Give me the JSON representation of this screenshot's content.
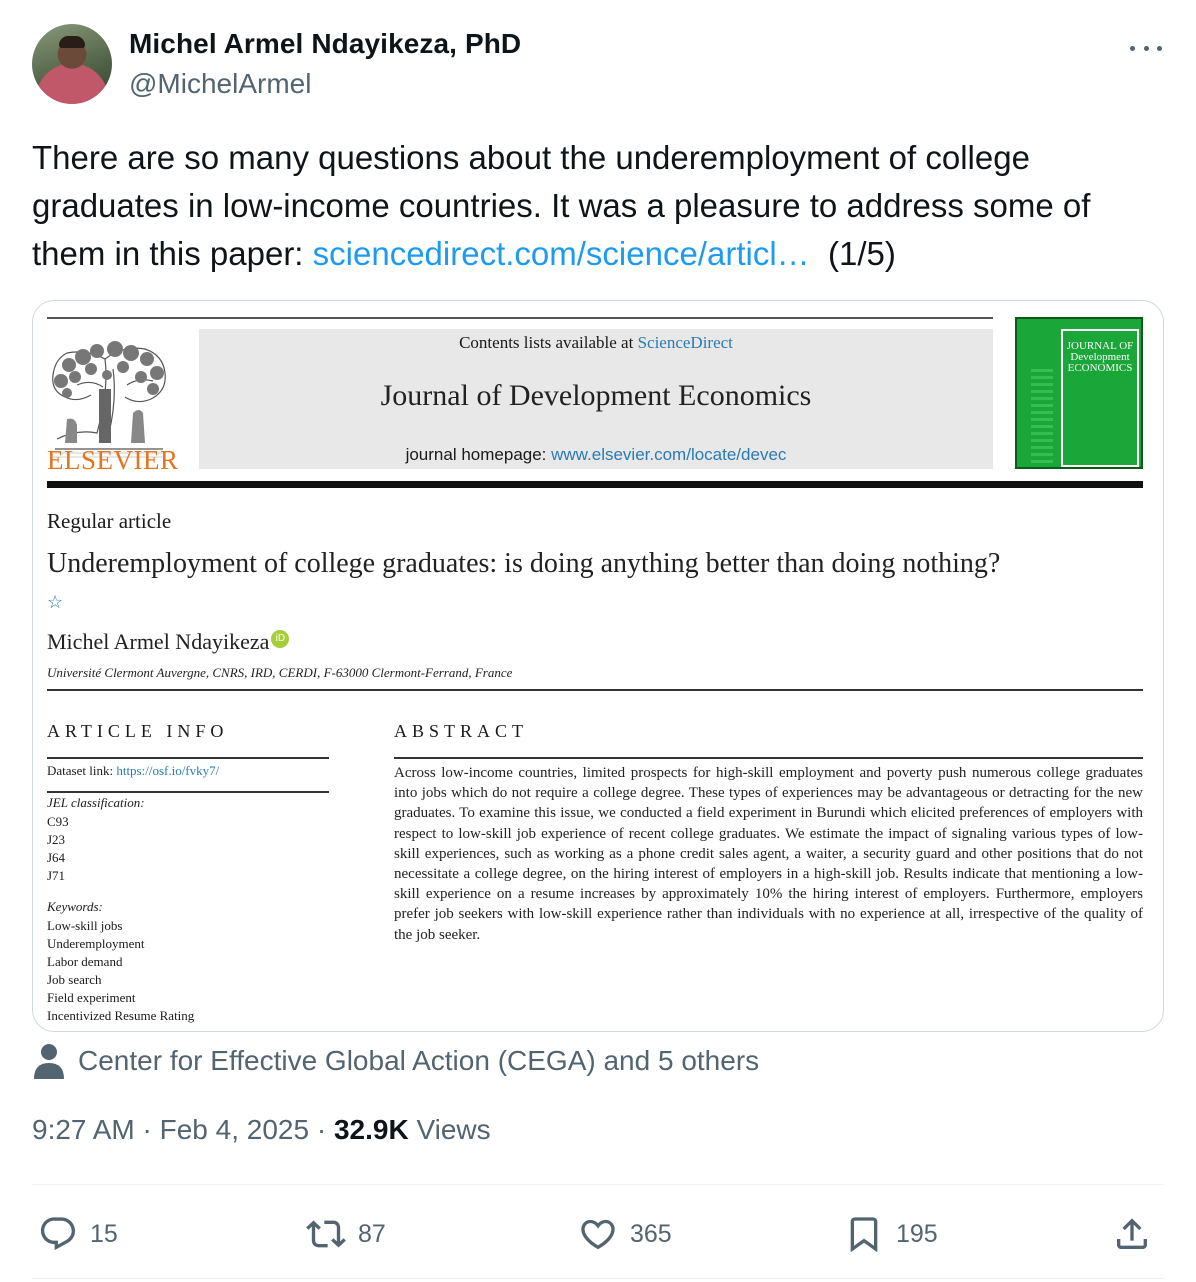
{
  "author": {
    "display_name": "Michel Armel Ndayikeza, PhD",
    "handle": "@MichelArmel"
  },
  "tweet": {
    "text_before_link": "There are so many questions about the underemployment of college graduates in low-income countries. It was a pleasure to address some of them in this paper: ",
    "link_text": "sciencedirect.com/science/articl…",
    "text_after_link": "  (1/5)"
  },
  "paper": {
    "contents_prefix": "Contents lists available at ",
    "contents_link": "ScienceDirect",
    "journal_title": "Journal of Development Economics",
    "homepage_prefix": "journal homepage: ",
    "homepage_url": "www.elsevier.com/locate/devec",
    "publisher": "ELSEVIER",
    "cover_text": "JOURNAL OF Development ECONOMICS",
    "article_type": "Regular article",
    "title": "Underemployment of college graduates: is doing anything better than doing nothing?",
    "title_mark": "☆",
    "author_name": "Michel Armel Ndayikeza",
    "orcid_label": "iD",
    "affiliation": "Université Clermont Auvergne, CNRS, IRD, CERDI, F-63000 Clermont-Ferrand, France",
    "article_info_heading": "ARTICLE INFO",
    "dataset_prefix": "Dataset link: ",
    "dataset_url": "https://osf.io/fvky7/",
    "jel_label": "JEL classification:",
    "jel_codes": [
      "C93",
      "J23",
      "J64",
      "J71"
    ],
    "keywords_label": "Keywords:",
    "keywords": [
      "Low-skill jobs",
      "Underemployment",
      "Labor demand",
      "Job search",
      "Field experiment",
      "Incentivized Resume Rating"
    ],
    "abstract_heading": "ABSTRACT",
    "abstract": "Across low-income countries, limited prospects for high-skill employment and poverty push numerous college graduates into jobs which do not require a college degree. These types of experiences may be advantageous or detracting for the new graduates. To examine this issue, we conducted a field experiment in Burundi which elicited preferences of employers with respect to low-skill job experience of recent college graduates. We estimate the impact of signaling various types of low-skill experiences, such as working as a phone credit sales agent, a waiter, a security guard and other positions that do not necessitate a college degree, on the hiring interest of employers in a high-skill job. Results indicate that mentioning a low-skill experience on a resume increases by approximately 10% the hiring interest of employers. Furthermore, employers prefer job seekers with low-skill experience rather than individuals with no experience at all, irrespective of the quality of the job seeker."
  },
  "social_context": "Center for Effective Global Action (CEGA) and 5 others",
  "meta": {
    "time": "9:27 AM",
    "separator": " · ",
    "date": "Feb 4, 2025",
    "views_count": "32.9K",
    "views_label": " Views"
  },
  "actions": {
    "replies": "15",
    "reposts": "87",
    "likes": "365",
    "bookmarks": "195"
  },
  "icons": [
    "more-icon",
    "person-icon",
    "reply-icon",
    "repost-icon",
    "like-icon",
    "bookmark-icon",
    "share-icon"
  ],
  "colors": {
    "link": "#1d9bf0",
    "secondary_text": "#536471",
    "elsevier_orange": "#e8731d",
    "cover_green": "#1ba63a",
    "paper_link": "#2a7ab5"
  }
}
